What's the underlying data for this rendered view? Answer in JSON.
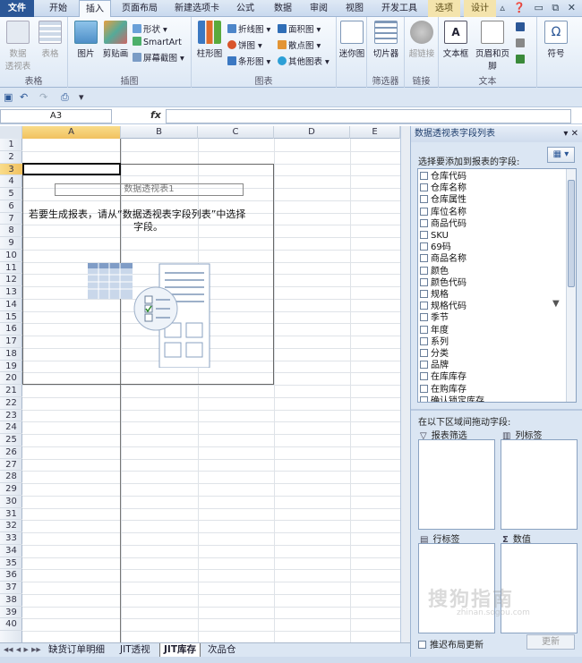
{
  "ribbon_tabs": [
    "文件",
    "开始",
    "插入",
    "页面布局",
    "新建选项卡",
    "公式",
    "数据",
    "审阅",
    "视图",
    "开发工具",
    "选项",
    "设计"
  ],
  "ribbon": {
    "tables_group": "表格",
    "pivot_btn": "数据\n透视表",
    "table_btn": "表格",
    "illustrations_group": "插图",
    "picture_btn": "图片",
    "clipart_btn": "剪贴画",
    "shapes_btn": "形状",
    "smartart_btn": "SmartArt",
    "screenshot_btn": "屏幕截图",
    "charts_group": "图表",
    "column_btn": "柱形图",
    "line_btn": "折线图",
    "pie_btn": "饼图",
    "bar_btn": "条形图",
    "area_btn": "面积图",
    "scatter_btn": "散点图",
    "other_btn": "其他图表",
    "sparkline_btn": "迷你图",
    "slicer_btn": "切片器",
    "filter_group": "筛选器",
    "hyperlink_btn": "超链接",
    "links_group": "链接",
    "textbox_btn": "文本框",
    "headerfooter_btn": "页眉和页脚",
    "text_group": "文本",
    "symbol_btn": "符号"
  },
  "name_box": "A3",
  "fx_label": "fx",
  "columns": [
    "A",
    "B",
    "C",
    "D",
    "E"
  ],
  "rows": [
    "1",
    "2",
    "3",
    "4",
    "5",
    "6",
    "7",
    "8",
    "9",
    "10",
    "11",
    "12",
    "13",
    "14",
    "15",
    "16",
    "17",
    "18",
    "19",
    "20",
    "21",
    "22",
    "23",
    "24",
    "25",
    "26",
    "27",
    "28",
    "29",
    "30",
    "31",
    "32",
    "33",
    "34",
    "35",
    "36",
    "37",
    "38",
    "39",
    "40"
  ],
  "pivot": {
    "name": "数据透视表1",
    "message_line1": "若要生成报表，请从“数据透视表字段列表”中选择",
    "message_line2": "字段。"
  },
  "sheet_tabs": [
    "缺货订单明细",
    "JIT透视",
    "JIT库存",
    "次品仓"
  ],
  "pane": {
    "title": "数据透视表字段列表",
    "choose_label": "选择要添加到报表的字段:",
    "fields": [
      "仓库代码",
      "仓库名称",
      "仓库属性",
      "库位名称",
      "商品代码",
      "SKU",
      "69码",
      "商品名称",
      "颜色",
      "颜色代码",
      "规格",
      "规格代码",
      "季节",
      "年度",
      "系列",
      "分类",
      "品牌",
      "在库库存",
      "在购库存",
      "确认锁定库存"
    ],
    "drag_label": "在以下区域间拖动字段:",
    "report_filter": "报表筛选",
    "column_labels": "列标签",
    "row_labels": "行标签",
    "values": "数值",
    "defer_update": "推迟布局更新",
    "update_btn": "更新"
  },
  "watermark": "搜狗指南",
  "watermark_sub": "zhinan.sogou.com"
}
